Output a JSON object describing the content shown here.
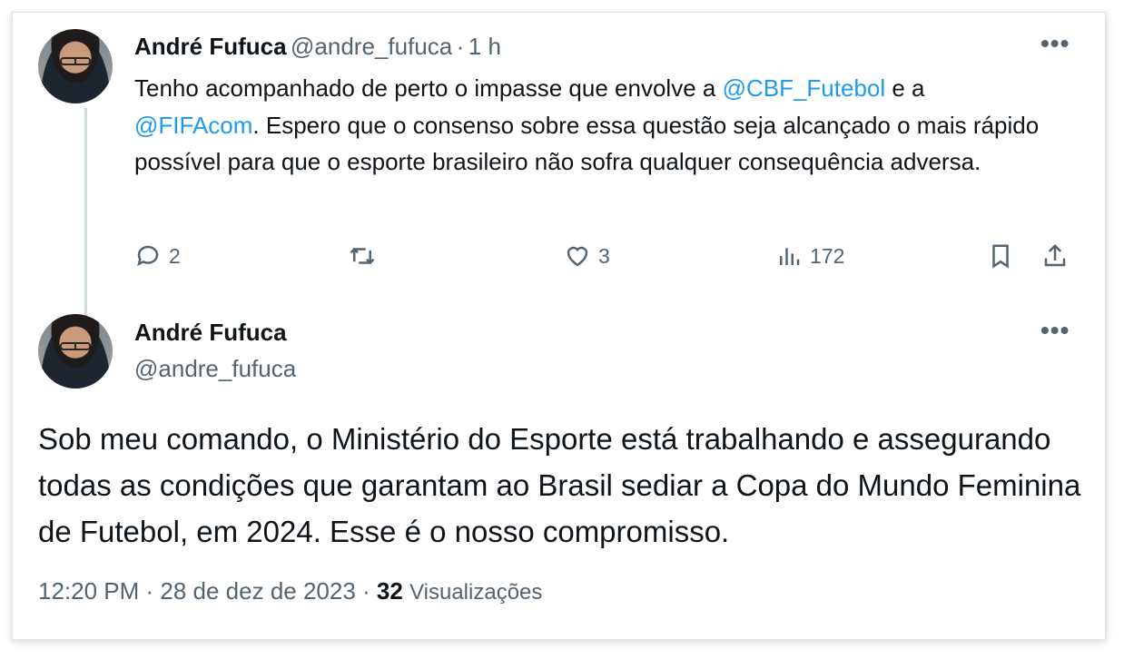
{
  "reply_tweet": {
    "author_name": "André Fufuca",
    "author_handle": "@andre_fufuca",
    "separator": "·",
    "time_ago": "1 h",
    "more_icon": "more-horizontal-icon",
    "text_before_mention1": "Tenho acompanhado de perto o impasse que envolve a ",
    "mention1": "@CBF_Futebol",
    "text_between": " e a",
    "mention2": "@FIFAcom",
    "text_after": ". Espero que o consenso sobre essa questão seja alcançado o mais rápido possível para que o esporte brasileiro não sofra qualquer consequência adversa.",
    "actions": {
      "reply_count": "2",
      "retweet_count": "",
      "like_count": "3",
      "views_count": "172"
    },
    "mention_color": "#1d9bf0"
  },
  "main_tweet": {
    "author_name": "André Fufuca",
    "author_handle": "@andre_fufuca",
    "text": "Sob meu comando, o Ministério do Esporte está trabalhando e assegurando todas as condições que garantam ao Brasil sediar a Copa do Mundo Feminina de Futebol, em 2024. Esse é o nosso compromisso.",
    "timestamp": "12:20 PM · 28 de dez de 2023 · ",
    "views_count": "32",
    "views_label": "Visualizações"
  }
}
